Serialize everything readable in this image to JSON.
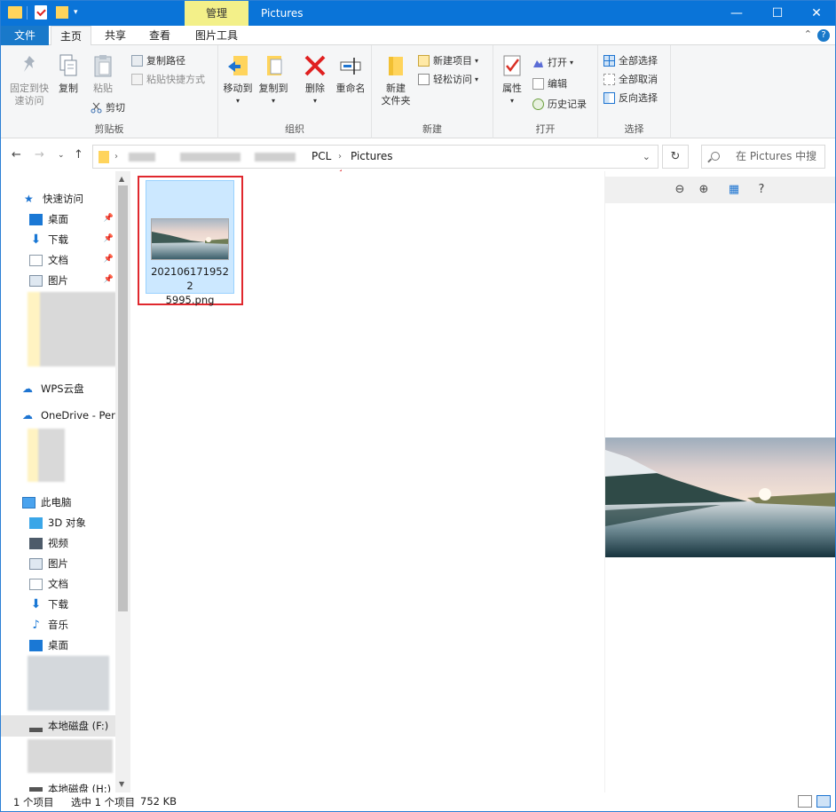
{
  "titlebar": {
    "context_tab": "管理",
    "title": "Pictures",
    "minimize": "—",
    "maximize": "☐",
    "close": "✕"
  },
  "tabs": {
    "file": "文件",
    "home": "主页",
    "share": "共享",
    "view": "查看",
    "picture_tools": "图片工具",
    "collapse": "⌃",
    "help": "?"
  },
  "ribbon": {
    "clipboard": {
      "label": "剪贴板",
      "pin_quick_access": "固定到快\n速访问",
      "pin_line1": "固定到快",
      "pin_line2": "速访问",
      "copy": "复制",
      "paste": "粘贴",
      "copy_path": "复制路径",
      "paste_shortcut": "粘贴快捷方式",
      "cut": "剪切"
    },
    "organize": {
      "label": "组织",
      "move_to": "移动到",
      "copy_to": "复制到",
      "delete": "删除",
      "rename": "重命名"
    },
    "new": {
      "label": "新建",
      "new_folder_line1": "新建",
      "new_folder_line2": "文件夹",
      "new_item": "新建项目",
      "easy_access": "轻松访问"
    },
    "open": {
      "label": "打开",
      "properties": "属性",
      "open": "打开",
      "edit": "编辑",
      "history": "历史记录"
    },
    "select": {
      "label": "选择",
      "select_all": "全部选择",
      "select_none": "全部取消",
      "invert": "反向选择"
    }
  },
  "address": {
    "crumb1": "PCL",
    "crumb2": "Pictures",
    "search_placeholder": "在 Pictures 中搜索"
  },
  "navpane": {
    "quick_access": "快速访问",
    "desktop": "桌面",
    "downloads": "下载",
    "documents": "文档",
    "pictures": "图片",
    "wps": "WPS云盘",
    "onedrive": "OneDrive - Pers",
    "this_pc": "此电脑",
    "objects3d": "3D 对象",
    "videos": "视频",
    "pictures2": "图片",
    "documents2": "文档",
    "downloads2": "下载",
    "music": "音乐",
    "desktop2": "桌面",
    "local_disk_f": "本地磁盘 (F:)",
    "local_disk_partial": "本地磁盘 (H:)"
  },
  "file": {
    "name_line1": "2021061719522",
    "name_line2": "5995.png"
  },
  "status": {
    "count": "1 个项目",
    "selected": "选中 1 个项目",
    "size": "752 KB"
  },
  "colors": {
    "titlebar": "#0a74d8",
    "context_tab": "#f3f089",
    "selection": "#cce8ff",
    "annotation": "#e0282e"
  }
}
